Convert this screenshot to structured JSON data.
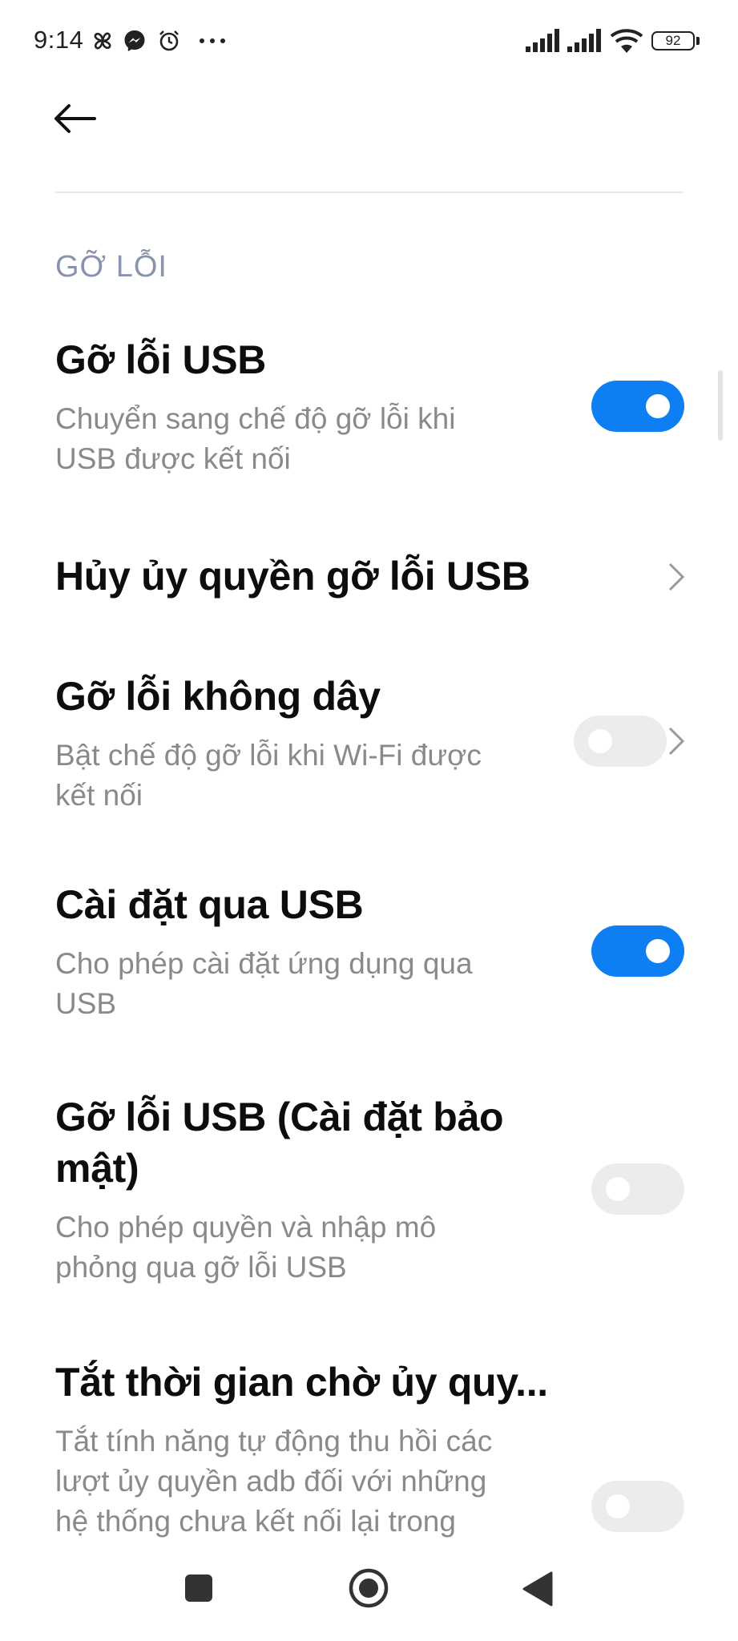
{
  "status_bar": {
    "time": "9:14",
    "battery": "92",
    "icons": [
      "pinwheel-icon",
      "messenger-icon",
      "alarm-icon",
      "more-dots-icon",
      "signal-icon",
      "signal-icon",
      "wifi-icon",
      "battery-icon"
    ]
  },
  "header": {
    "back_icon": "arrow-left-icon"
  },
  "section": {
    "title": "GỠ LỖI"
  },
  "settings": [
    {
      "title": "Gỡ lỗi USB",
      "subtitle_lines": [
        "Chuyển sang chế độ gỡ lỗi khi",
        "USB được kết nối"
      ],
      "control": "toggle",
      "enabled": true
    },
    {
      "title": "Hủy ủy quyền gỡ lỗi USB",
      "subtitle_lines": [],
      "control": "chevron"
    },
    {
      "title": "Gỡ lỗi không dây",
      "subtitle_lines": [
        "Bật chế độ gỡ lỗi khi Wi-Fi được",
        "kết nối"
      ],
      "control": "toggle+chevron",
      "enabled": false
    },
    {
      "title": "Cài đặt qua USB",
      "subtitle_lines": [
        "Cho phép cài đặt ứng dụng qua",
        "USB"
      ],
      "control": "toggle",
      "enabled": true
    },
    {
      "title_lines": [
        "Gỡ lỗi USB (Cài đặt bảo",
        "mật)"
      ],
      "subtitle_lines": [
        "Cho phép quyền và nhập mô",
        "phỏng qua gỡ lỗi USB"
      ],
      "control": "toggle",
      "enabled": false
    },
    {
      "title": "Tắt thời gian chờ ủy quy...",
      "subtitle_lines": [
        "Tắt tính năng tự động thu hồi các",
        "lượt ủy quyền adb đối với những",
        "hệ thống chưa kết nối lại trong"
      ],
      "control": "toggle",
      "enabled": false
    }
  ],
  "nav_bar": {
    "buttons": [
      "recents-square-icon",
      "home-circle-icon",
      "back-triangle-icon"
    ]
  },
  "colors": {
    "accent": "#0d7ff2",
    "toggle_off": "#ececec",
    "section_header": "#8a93ad",
    "subtitle": "#8a8a8a"
  }
}
